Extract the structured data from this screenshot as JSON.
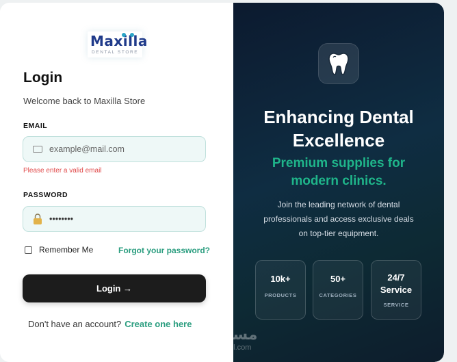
{
  "brand": {
    "name": "Maxilla",
    "tagline": "DENTAL STORE"
  },
  "form": {
    "title": "Login",
    "subtitle": "Welcome back to Maxilla Store",
    "email_label": "EMAIL",
    "email_placeholder": "example@mail.com",
    "email_error": "Please enter a valid email",
    "password_label": "PASSWORD",
    "password_value": "••••••••",
    "remember_label": "Remember Me",
    "forgot_label": "Forgot your password?",
    "login_button": "Login →",
    "signup_prompt": "Don't have an account?",
    "signup_link": "Create one here"
  },
  "hero": {
    "title_line1": "Enhancing Dental",
    "title_line2": "Excellence",
    "subtitle_line1": "Premium supplies for",
    "subtitle_line2": "modern clinics.",
    "description": "Join the leading network of dental professionals and access exclusive deals on top-tier equipment.",
    "icon": "tooth-icon",
    "stats": [
      {
        "value": "10k+",
        "label": "PRODUCTS"
      },
      {
        "value": "50+",
        "label": "CATEGORIES"
      },
      {
        "value_line1": "24/7",
        "value_line2": "Service",
        "label": "SERVICE"
      }
    ]
  },
  "watermark": {
    "arabic": "مستقل",
    "latin": "mostaql.com"
  },
  "colors": {
    "accent": "#2a9d7f",
    "error": "#e04848",
    "dark_button": "#1c1c1c",
    "panel_bg": "#0f2d42",
    "field_bg": "#eef8f7"
  }
}
